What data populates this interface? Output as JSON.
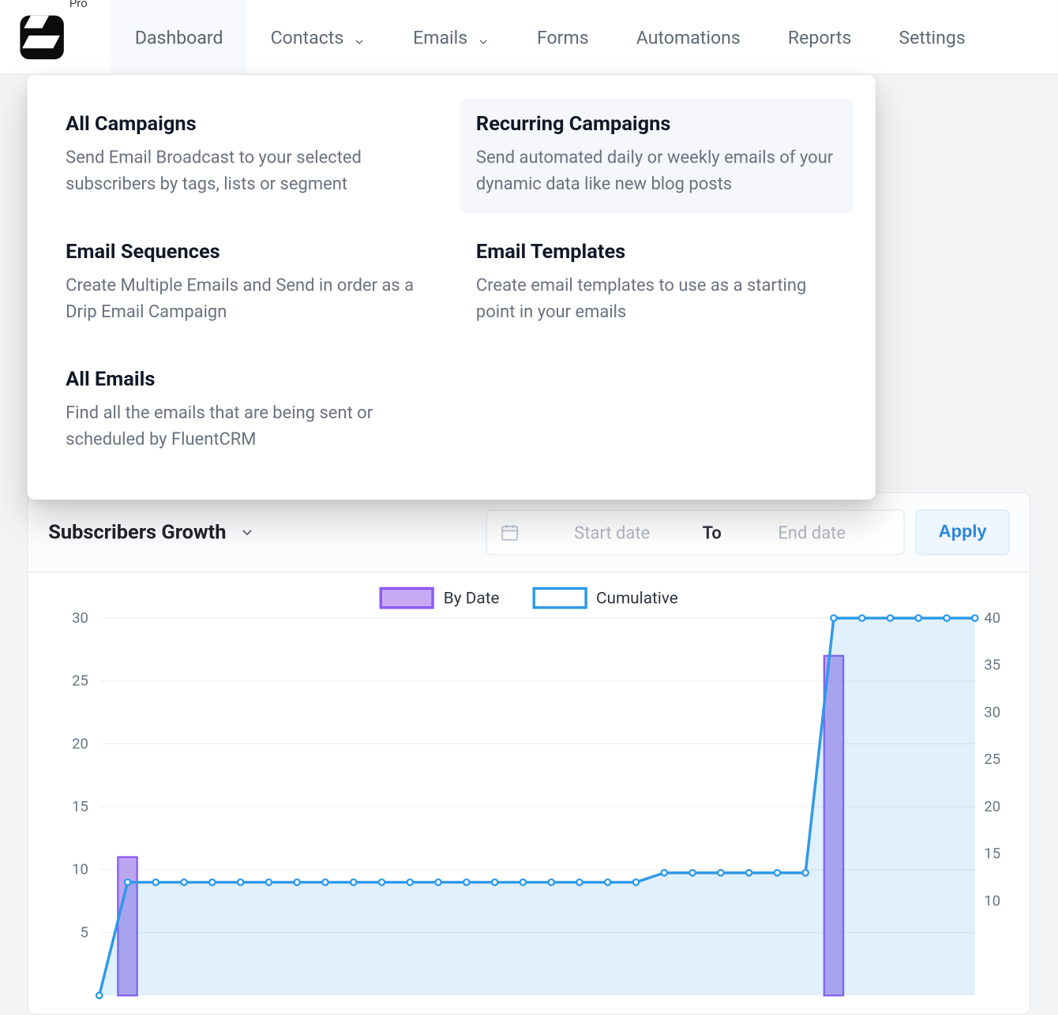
{
  "brand": {
    "tier": "Pro"
  },
  "nav": {
    "items": [
      {
        "label": "Dashboard",
        "has_chevron": false,
        "active": true
      },
      {
        "label": "Contacts",
        "has_chevron": true,
        "active": false
      },
      {
        "label": "Emails",
        "has_chevron": true,
        "active": false
      },
      {
        "label": "Forms",
        "has_chevron": false,
        "active": false
      },
      {
        "label": "Automations",
        "has_chevron": false,
        "active": false
      },
      {
        "label": "Reports",
        "has_chevron": false,
        "active": false
      },
      {
        "label": "Settings",
        "has_chevron": false,
        "active": false
      }
    ]
  },
  "emails_dropdown": {
    "items": [
      {
        "title": "All Campaigns",
        "desc": "Send Email Broadcast to your selected subscribers by tags, lists or segment",
        "highlight": false
      },
      {
        "title": "Recurring Campaigns",
        "desc": "Send automated daily or weekly emails of your dynamic data like new blog posts",
        "highlight": true
      },
      {
        "title": "Email Sequences",
        "desc": "Create Multiple Emails and Send in order as a Drip Email Campaign",
        "highlight": false
      },
      {
        "title": "Email Templates",
        "desc": "Create email templates to use as a starting point in your emails",
        "highlight": false
      },
      {
        "title": "All Emails",
        "desc": "Find all the emails that are being sent or scheduled by FluentCRM",
        "highlight": false
      }
    ]
  },
  "chart_panel": {
    "title": "Subscribers Growth",
    "date": {
      "start_placeholder": "Start date",
      "to": "To",
      "end_placeholder": "End date",
      "apply": "Apply"
    },
    "legend": {
      "by_date": "By Date",
      "cumulative": "Cumulative"
    }
  },
  "chart_data": {
    "type": "bar+line",
    "title": "Subscribers Growth",
    "xlabel": "",
    "ylabel_left": "By Date",
    "ylabel_right": "Cumulative",
    "ylim_left": [
      0,
      30
    ],
    "ylim_right": [
      0,
      40
    ],
    "y_ticks_left": [
      5,
      10,
      15,
      20,
      25,
      30
    ],
    "y_ticks_right": [
      10,
      15,
      20,
      25,
      30,
      35,
      40
    ],
    "categories_count": 32,
    "series": [
      {
        "name": "By Date",
        "kind": "bar",
        "axis": "left",
        "color": "#8b5cf6",
        "values": [
          0,
          11,
          0,
          0,
          0,
          0,
          0,
          0,
          0,
          0,
          0,
          0,
          0,
          0,
          0,
          0,
          0,
          0,
          0,
          0,
          0,
          0,
          0,
          0,
          0,
          0,
          27,
          0,
          0,
          0,
          0,
          0
        ]
      },
      {
        "name": "Cumulative",
        "kind": "line-area",
        "axis": "right",
        "color": "#2f99e8",
        "values": [
          0,
          12,
          12,
          12,
          12,
          12,
          12,
          12,
          12,
          12,
          12,
          12,
          12,
          12,
          12,
          12,
          12,
          12,
          12,
          12,
          13,
          13,
          13,
          13,
          13,
          13,
          40,
          40,
          40,
          40,
          40,
          40
        ]
      }
    ]
  }
}
